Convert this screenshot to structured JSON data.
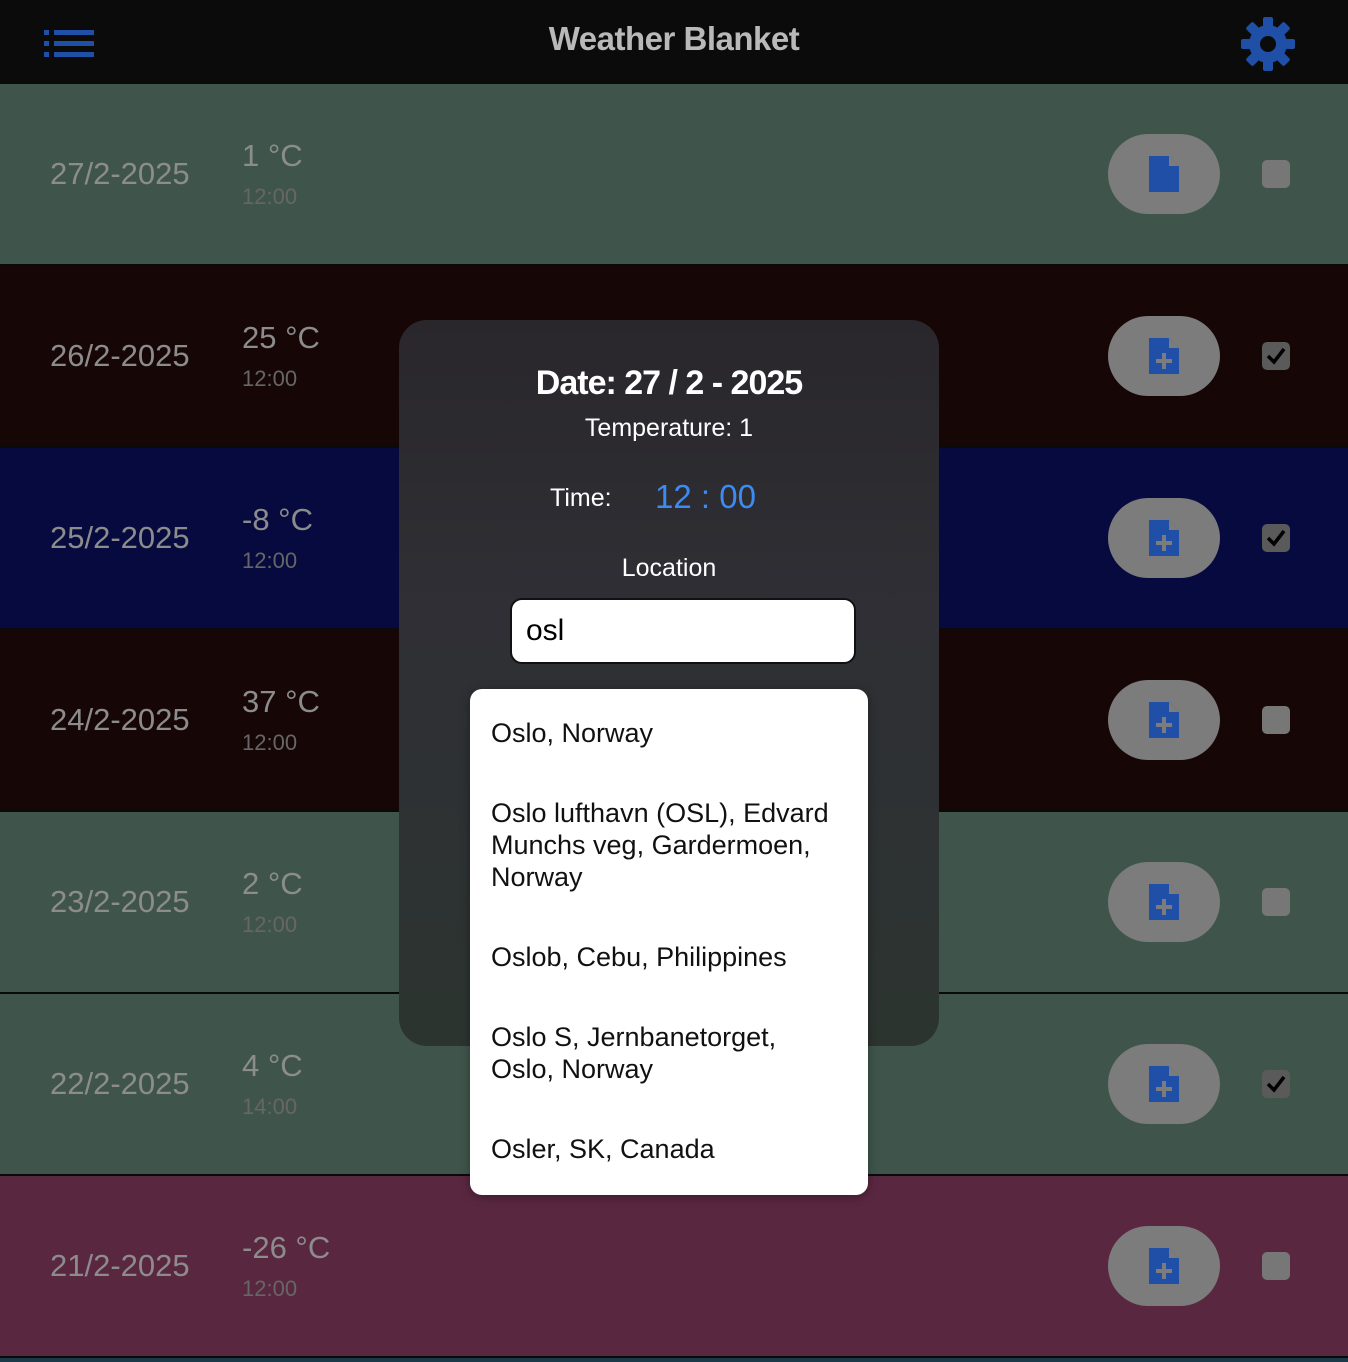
{
  "app": {
    "title": "Weather Blanket"
  },
  "header": {
    "menu_icon": "list-icon",
    "settings_icon": "gear-icon",
    "accent": "#1f4fa6"
  },
  "rows": [
    {
      "date": "27/2-2025",
      "temp": "1 °C",
      "time": "12:00",
      "color": "#3f554c",
      "icon": "document-icon",
      "checked": false
    },
    {
      "date": "26/2-2025",
      "temp": "25 °C",
      "time": "12:00",
      "color": "#170606",
      "icon": "document-plus-icon",
      "checked": true
    },
    {
      "date": "25/2-2025",
      "temp": "-8 °C",
      "time": "12:00",
      "color": "#060a3e",
      "icon": "document-plus-icon",
      "checked": true
    },
    {
      "date": "24/2-2025",
      "temp": "37 °C",
      "time": "12:00",
      "color": "#170606",
      "icon": "document-plus-icon",
      "checked": false
    },
    {
      "date": "23/2-2025",
      "temp": "2 °C",
      "time": "12:00",
      "color": "#3f554c",
      "icon": "document-plus-icon",
      "checked": false
    },
    {
      "date": "22/2-2025",
      "temp": "4 °C",
      "time": "14:00",
      "color": "#3f554c",
      "icon": "document-plus-icon",
      "checked": true
    },
    {
      "date": "21/2-2025",
      "temp": "-26 °C",
      "time": "12:00",
      "color": "#5a2741",
      "icon": "document-plus-icon",
      "checked": false
    }
  ],
  "modal": {
    "date": "Date: 27 / 2 - 2025",
    "temperature": "Temperature: 1",
    "time_label": "Time:",
    "time_value": "12 : 00",
    "location_label": "Location",
    "location_value": "osl"
  },
  "suggestions": [
    "Oslo, Norway",
    "Oslo lufthavn (OSL), Edvard Munchs veg, Gardermoen, Norway",
    "Oslob, Cebu, Philippines",
    "Oslo S, Jernbanetorget, Oslo, Norway",
    "Osler, SK, Canada"
  ]
}
